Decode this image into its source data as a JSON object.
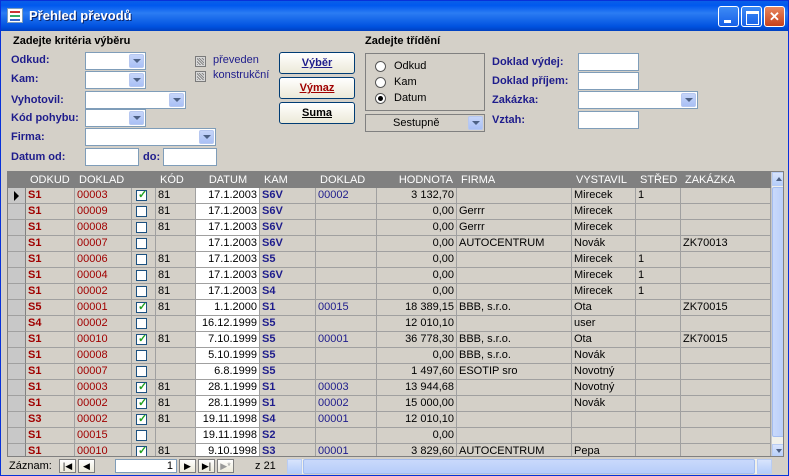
{
  "window": {
    "title": "Přehled převodů"
  },
  "criteria": {
    "heading": "Zadejte kritéria výběru",
    "odkud_label": "Odkud:",
    "kam_label": "Kam:",
    "vyhotovil_label": "Vyhotovil:",
    "kod_pohybu_label": "Kód pohybu:",
    "firma_label": "Firma:",
    "datum_od_label": "Datum od:",
    "do_label": "do:",
    "preveden_label": "převeden",
    "konstrukcni_label": "konstrukční"
  },
  "buttons": {
    "vyber": "Výběr",
    "vymaz": "Výmaz",
    "suma": "Suma"
  },
  "sort": {
    "heading": "Zadejte třídění",
    "options": [
      "Odkud",
      "Kam",
      "Datum"
    ],
    "selected": "Datum",
    "order": "Sestupně"
  },
  "right_fields": {
    "doklad_vydej": "Doklad výdej:",
    "doklad_prijem": "Doklad příjem:",
    "zakazka": "Zakázka:",
    "vztah": "Vztah:"
  },
  "grid": {
    "columns": [
      "ODKUD",
      "DOKLAD",
      "KÓD",
      "DATUM",
      "KAM",
      "DOKLAD",
      "HODNOTA",
      "FIRMA",
      "VYSTAVIL",
      "STŘED.",
      "ZAKÁZKA"
    ],
    "rows": [
      {
        "odkud": "S1",
        "doklad": "00003",
        "checked": true,
        "kod": "81",
        "datum": "17.1.2003",
        "kam": "S6V",
        "doklad2": "00002",
        "hodnota": "3 132,70",
        "firma": "",
        "vystavil": "Mirecek",
        "stred": "1",
        "zakazka": ""
      },
      {
        "odkud": "S1",
        "doklad": "00009",
        "checked": false,
        "kod": "81",
        "datum": "17.1.2003",
        "kam": "S6V",
        "doklad2": "",
        "hodnota": "0,00",
        "firma": "Gerrr",
        "vystavil": "Mirecek",
        "stred": "",
        "zakazka": ""
      },
      {
        "odkud": "S1",
        "doklad": "00008",
        "checked": false,
        "kod": "81",
        "datum": "17.1.2003",
        "kam": "S6V",
        "doklad2": "",
        "hodnota": "0,00",
        "firma": "Gerrr",
        "vystavil": "Mirecek",
        "stred": "",
        "zakazka": ""
      },
      {
        "odkud": "S1",
        "doklad": "00007",
        "checked": false,
        "kod": "",
        "datum": "17.1.2003",
        "kam": "S6V",
        "doklad2": "",
        "hodnota": "0,00",
        "firma": "AUTOCENTRUM",
        "vystavil": "Novák",
        "stred": "",
        "zakazka": "ZK70013"
      },
      {
        "odkud": "S1",
        "doklad": "00006",
        "checked": false,
        "kod": "81",
        "datum": "17.1.2003",
        "kam": "S5",
        "doklad2": "",
        "hodnota": "0,00",
        "firma": "",
        "vystavil": "Mirecek",
        "stred": "1",
        "zakazka": ""
      },
      {
        "odkud": "S1",
        "doklad": "00004",
        "checked": false,
        "kod": "81",
        "datum": "17.1.2003",
        "kam": "S6V",
        "doklad2": "",
        "hodnota": "0,00",
        "firma": "",
        "vystavil": "Mirecek",
        "stred": "1",
        "zakazka": ""
      },
      {
        "odkud": "S1",
        "doklad": "00002",
        "checked": false,
        "kod": "81",
        "datum": "17.1.2003",
        "kam": "S4",
        "doklad2": "",
        "hodnota": "0,00",
        "firma": "",
        "vystavil": "Mirecek",
        "stred": "1",
        "zakazka": ""
      },
      {
        "odkud": "S5",
        "doklad": "00001",
        "checked": true,
        "kod": "81",
        "datum": "1.1.2000",
        "kam": "S1",
        "doklad2": "00015",
        "hodnota": "18 389,15",
        "firma": "BBB, s.r.o.",
        "vystavil": "Ota",
        "stred": "",
        "zakazka": "ZK70015"
      },
      {
        "odkud": "S4",
        "doklad": "00002",
        "checked": false,
        "kod": "",
        "datum": "16.12.1999",
        "kam": "S5",
        "doklad2": "",
        "hodnota": "12 010,10",
        "firma": "",
        "vystavil": "user",
        "stred": "",
        "zakazka": ""
      },
      {
        "odkud": "S1",
        "doklad": "00010",
        "checked": true,
        "kod": "81",
        "datum": "7.10.1999",
        "kam": "S5",
        "doklad2": "00001",
        "hodnota": "36 778,30",
        "firma": "BBB, s.r.o.",
        "vystavil": "Ota",
        "stred": "",
        "zakazka": "ZK70015"
      },
      {
        "odkud": "S1",
        "doklad": "00008",
        "checked": false,
        "kod": "",
        "datum": "5.10.1999",
        "kam": "S5",
        "doklad2": "",
        "hodnota": "0,00",
        "firma": "BBB, s.r.o.",
        "vystavil": "Novák",
        "stred": "",
        "zakazka": ""
      },
      {
        "odkud": "S1",
        "doklad": "00007",
        "checked": false,
        "kod": "",
        "datum": "6.8.1999",
        "kam": "S5",
        "doklad2": "",
        "hodnota": "1 497,60",
        "firma": "ESOTIP sro",
        "vystavil": "Novotný",
        "stred": "",
        "zakazka": ""
      },
      {
        "odkud": "S1",
        "doklad": "00003",
        "checked": true,
        "kod": "81",
        "datum": "28.1.1999",
        "kam": "S1",
        "doklad2": "00003",
        "hodnota": "13 944,68",
        "firma": "",
        "vystavil": "Novotný",
        "stred": "",
        "zakazka": ""
      },
      {
        "odkud": "S1",
        "doklad": "00002",
        "checked": true,
        "kod": "81",
        "datum": "28.1.1999",
        "kam": "S1",
        "doklad2": "00002",
        "hodnota": "15 000,00",
        "firma": "",
        "vystavil": "Novák",
        "stred": "",
        "zakazka": ""
      },
      {
        "odkud": "S3",
        "doklad": "00002",
        "checked": true,
        "kod": "81",
        "datum": "19.11.1998",
        "kam": "S4",
        "doklad2": "00001",
        "hodnota": "12 010,10",
        "firma": "",
        "vystavil": "",
        "stred": "",
        "zakazka": ""
      },
      {
        "odkud": "S1",
        "doklad": "00015",
        "checked": false,
        "kod": "",
        "datum": "19.11.1998",
        "kam": "S2",
        "doklad2": "",
        "hodnota": "0,00",
        "firma": "",
        "vystavil": "",
        "stred": "",
        "zakazka": ""
      },
      {
        "odkud": "S1",
        "doklad": "00010",
        "checked": true,
        "kod": "81",
        "datum": "9.10.1998",
        "kam": "S3",
        "doklad2": "00001",
        "hodnota": "3 829,60",
        "firma": "AUTOCENTRUM",
        "vystavil": "Pepa",
        "stred": "",
        "zakazka": ""
      }
    ]
  },
  "navigation": {
    "label": "Záznam:",
    "current": "1",
    "of_label": "z",
    "total": "21"
  }
}
